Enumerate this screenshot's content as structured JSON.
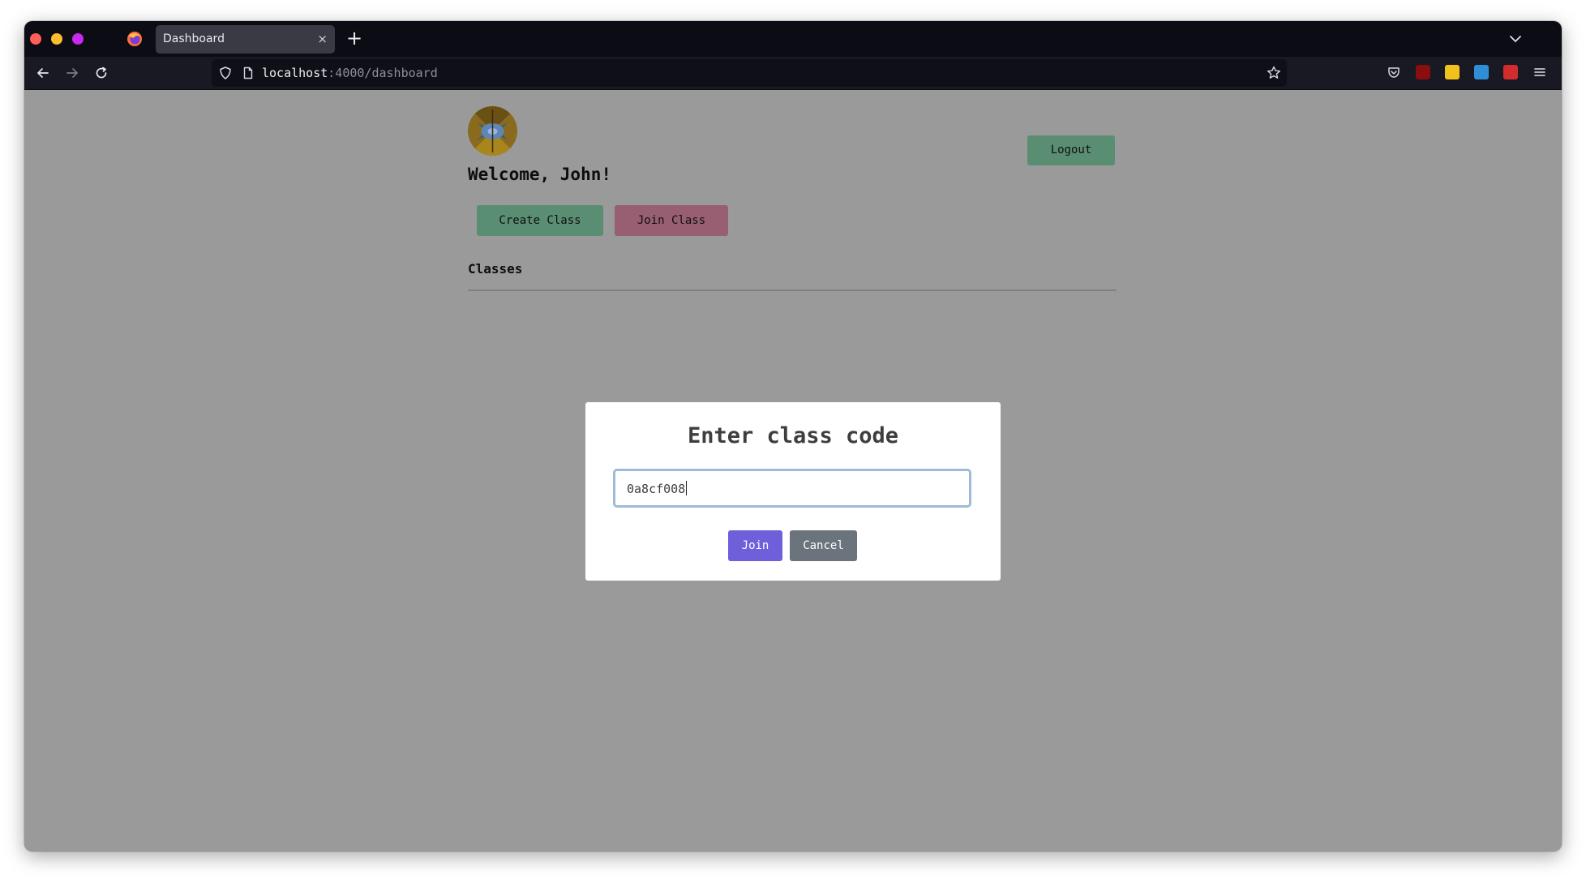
{
  "browser": {
    "tab_title": "Dashboard",
    "tab_close_glyph": "×",
    "new_tab_glyph": "+",
    "url_host": "localhost",
    "url_rest": ":4000/dashboard",
    "icons": [
      "back-icon",
      "forward-icon",
      "reload-icon",
      "shield-icon",
      "page-icon",
      "bookmark-star-icon",
      "pocket-icon",
      "ublock-icon",
      "extension-icon",
      "extension-badge-icon",
      "extension-red-icon",
      "menu-icon",
      "firefox-logo",
      "tab-list-chevron-icon"
    ],
    "colors": {
      "tabbar": "#0c0c14",
      "navbar": "#191923",
      "urlbar": "#0f0f18"
    }
  },
  "page": {
    "welcome": "Welcome, John!",
    "logout_label": "Logout",
    "create_class_label": "Create Class",
    "join_class_label": "Join Class",
    "classes_heading": "Classes",
    "colors": {
      "backdrop": "#9a9a9a",
      "green_button": "#5a8e72",
      "rose_button": "#985f72"
    }
  },
  "modal": {
    "title": "Enter class code",
    "input_value": "0a8cf008",
    "join_label": "Join",
    "cancel_label": "Cancel",
    "colors": {
      "join_button": "#6e5fdb",
      "cancel_button": "#6b747d",
      "input_focus_border": "#9dbbd8"
    }
  }
}
